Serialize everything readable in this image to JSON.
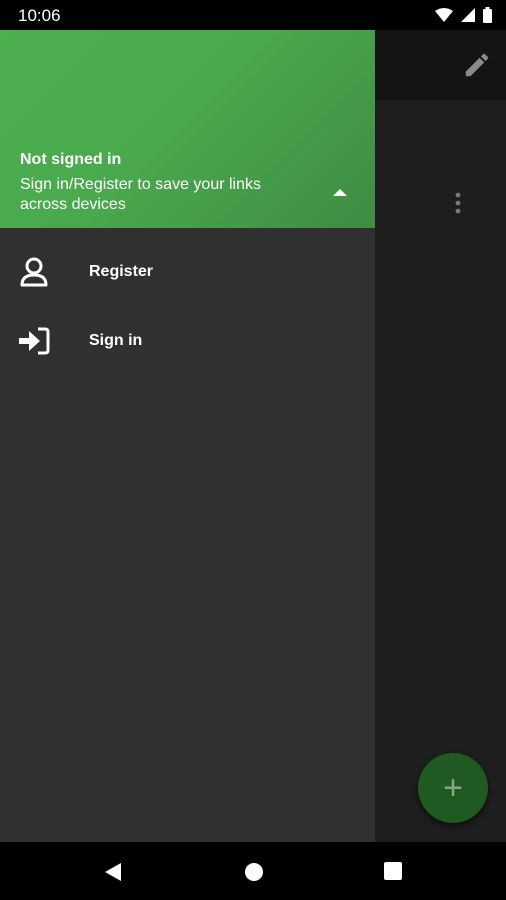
{
  "status_bar": {
    "time": "10:06",
    "icons": [
      "wifi-icon",
      "signal-icon",
      "battery-icon"
    ]
  },
  "background_app": {
    "toolbar_icon": "edit-icon",
    "overflow_icon": "more-vert-icon",
    "fab_icon": "plus-icon",
    "fab_label": "+"
  },
  "drawer": {
    "header": {
      "title": "Not signed in",
      "subtitle": "Sign in/Register to save your links across devices",
      "toggle_icon": "arrow-drop-up-icon"
    },
    "items": [
      {
        "label": "Register",
        "icon": "person-icon"
      },
      {
        "label": "Sign in",
        "icon": "sign-in-icon"
      }
    ]
  },
  "nav_bar": {
    "buttons": [
      "back-icon",
      "home-icon",
      "recents-icon"
    ]
  },
  "colors": {
    "accent": "#4caf50",
    "drawer_background": "#303030",
    "fab": "#1f5a22"
  }
}
